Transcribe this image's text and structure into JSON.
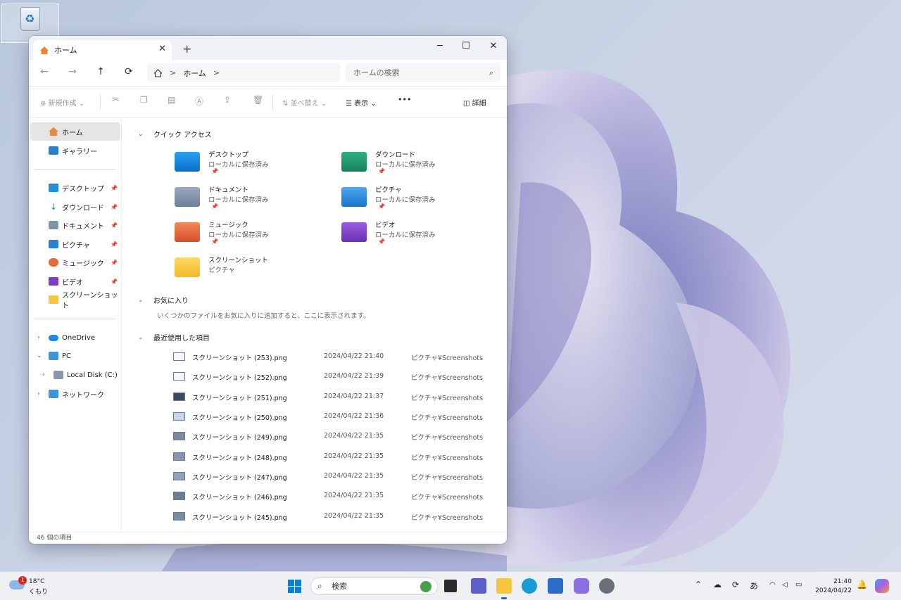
{
  "window": {
    "tab_title": "ホーム",
    "new_tab": "+",
    "minimize": "─",
    "maximize": "☐",
    "close": "✕",
    "tab_close": "✕"
  },
  "nav": {
    "back": "←",
    "forward": "→",
    "up": "↑",
    "refresh": "⟳",
    "path": "ホーム",
    "sep": ">",
    "search_placeholder": "ホームの検索"
  },
  "toolbar": {
    "new": "新規作成",
    "sort": "並べ替え",
    "view": "表示",
    "more": "•••",
    "details": "詳細"
  },
  "sidebar": {
    "home": "ホーム",
    "gallery": "ギャラリー",
    "desktop": "デスクトップ",
    "downloads": "ダウンロード",
    "documents": "ドキュメント",
    "pictures": "ピクチャ",
    "music": "ミュージック",
    "videos": "ビデオ",
    "screenshots": "スクリーンショット",
    "onedrive": "OneDrive",
    "pc": "PC",
    "localdisk": "Local Disk (C:)",
    "network": "ネットワーク"
  },
  "quick_access": {
    "title": "クイック アクセス",
    "items": [
      {
        "name": "デスクトップ",
        "sub": "ローカルに保存済み"
      },
      {
        "name": "ダウンロード",
        "sub": "ローカルに保存済み"
      },
      {
        "name": "ドキュメント",
        "sub": "ローカルに保存済み"
      },
      {
        "name": "ピクチャ",
        "sub": "ローカルに保存済み"
      },
      {
        "name": "ミュージック",
        "sub": "ローカルに保存済み"
      },
      {
        "name": "ビデオ",
        "sub": "ローカルに保存済み"
      },
      {
        "name": "スクリーンショット",
        "sub": "ピクチャ"
      }
    ]
  },
  "favorites": {
    "title": "お気に入り",
    "message": "いくつかのファイルをお気に入りに追加すると、ここに表示されます。"
  },
  "recent": {
    "title": "最近使用した項目",
    "rows": [
      {
        "name": "スクリーンショット (253).png",
        "date": "2024/04/22 21:40",
        "loc": "ピクチャ¥Screenshots"
      },
      {
        "name": "スクリーンショット (252).png",
        "date": "2024/04/22 21:39",
        "loc": "ピクチャ¥Screenshots"
      },
      {
        "name": "スクリーンショット (251).png",
        "date": "2024/04/22 21:37",
        "loc": "ピクチャ¥Screenshots"
      },
      {
        "name": "スクリーンショット (250).png",
        "date": "2024/04/22 21:36",
        "loc": "ピクチャ¥Screenshots"
      },
      {
        "name": "スクリーンショット (249).png",
        "date": "2024/04/22 21:35",
        "loc": "ピクチャ¥Screenshots"
      },
      {
        "name": "スクリーンショット (248).png",
        "date": "2024/04/22 21:35",
        "loc": "ピクチャ¥Screenshots"
      },
      {
        "name": "スクリーンショット (247).png",
        "date": "2024/04/22 21:35",
        "loc": "ピクチャ¥Screenshots"
      },
      {
        "name": "スクリーンショット (246).png",
        "date": "2024/04/22 21:35",
        "loc": "ピクチャ¥Screenshots"
      },
      {
        "name": "スクリーンショット (245).png",
        "date": "2024/04/22 21:35",
        "loc": "ピクチャ¥Screenshots"
      }
    ]
  },
  "status": "46 個の項目",
  "taskbar": {
    "badge": "1",
    "temp": "18°C",
    "condition": "くもり",
    "search": "検索",
    "ime": "あ",
    "time": "21:40",
    "date": "2024/04/22"
  },
  "colors": {
    "accent": "#0a7fd8",
    "folder_yellow": "#f6c640",
    "download_green": "#1f9a6a",
    "video_purple": "#7a3fc4",
    "music_orange": "#e86a3a"
  }
}
